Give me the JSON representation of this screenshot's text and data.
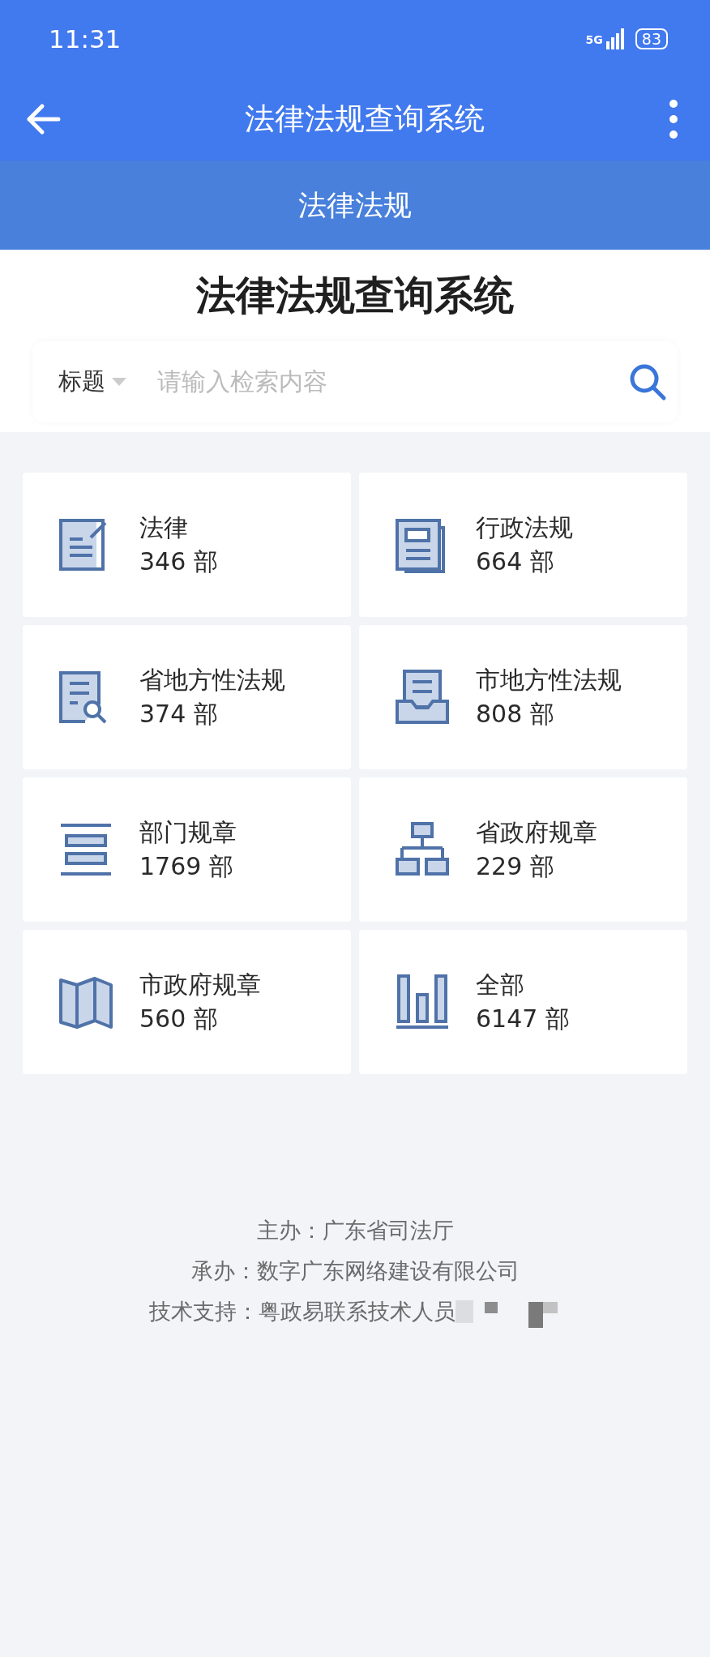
{
  "status_bar": {
    "time": "11:31",
    "network": "5G",
    "battery": "83"
  },
  "app_bar": {
    "title": "法律法规查询系统"
  },
  "tabs": [
    {
      "label": "法律法规",
      "selected": true
    }
  ],
  "page_title": "法律法规查询系统",
  "search": {
    "field_select": "标题",
    "placeholder": "请输入检索内容"
  },
  "categories": [
    {
      "name": "法律",
      "count": "346 部"
    },
    {
      "name": "行政法规",
      "count": "664 部"
    },
    {
      "name": "省地方性法规",
      "count": "374 部"
    },
    {
      "name": "市地方性法规",
      "count": "808 部"
    },
    {
      "name": "部门规章",
      "count": "1769 部"
    },
    {
      "name": "省政府规章",
      "count": "229 部"
    },
    {
      "name": "市政府规章",
      "count": "560 部"
    },
    {
      "name": "全部",
      "count": "6147 部"
    }
  ],
  "footer": [
    "主办：广东省司法厅",
    "承办：数字广东网络建设有限公司",
    "技术支持：粤政易联系技术人员"
  ]
}
